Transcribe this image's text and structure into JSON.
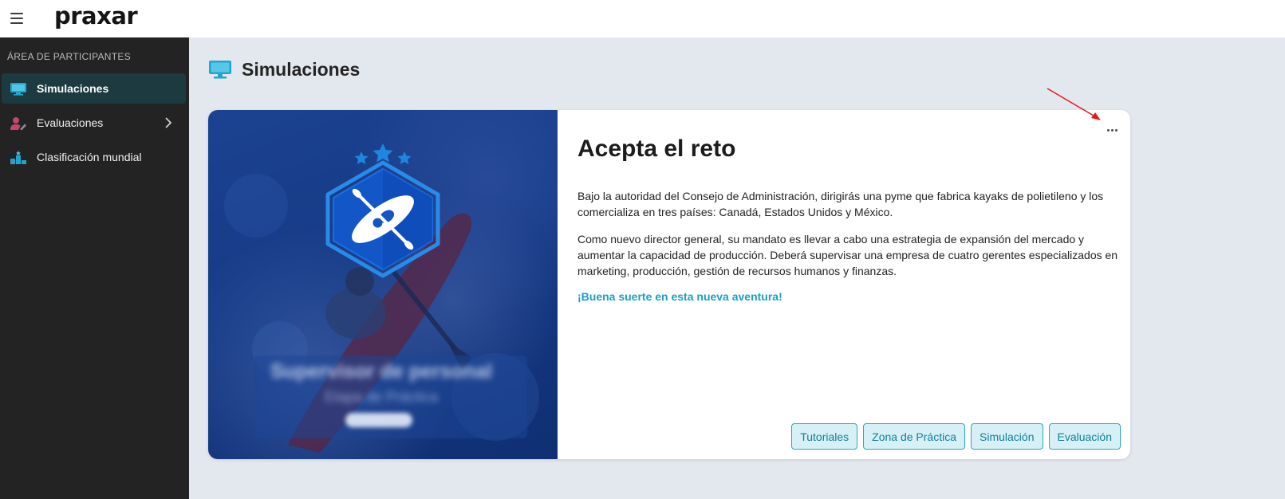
{
  "app": {
    "logo_text": "praxar",
    "colors": {
      "accent": "#1aa0c4",
      "sidebar_bg": "#232323",
      "sidebar_active": "#1c3a40"
    }
  },
  "topbar": {
    "menu_icon": "hamburger-icon"
  },
  "sidebar": {
    "heading": "ÁREA DE PARTICIPANTES",
    "items": [
      {
        "label": "Simulaciones",
        "icon": "monitor-icon",
        "active": true
      },
      {
        "label": "Evaluaciones",
        "icon": "user-edit-icon",
        "has_submenu": true
      },
      {
        "label": "Clasificación mundial",
        "icon": "podium-icon"
      }
    ]
  },
  "page": {
    "title": "Simulaciones",
    "title_icon": "monitor-icon"
  },
  "card": {
    "title": "Acepta el reto",
    "paragraphs": [
      "Bajo la autoridad del Consejo de Administración, dirigirás una pyme que fabrica kayaks de polietileno y los comercializa en tres países: Canadá, Estados Unidos y México.",
      "Como nuevo director general, su mandato es llevar a cabo una estrategia de expansión del mercado y aumentar la capacidad de producción. Deberá supervisar una empresa de cuatro gerentes especializados en marketing, producción, gestión de recursos humanos y finanzas."
    ],
    "highlight": "¡Buena suerte en esta nueva aventura!",
    "image_badge_icon": "kayak-badge-icon",
    "blurred_overlay": {
      "title": "Supervisor de personal",
      "subtitle": "Etapa de Práctica"
    },
    "actions": [
      {
        "label": "Tutoriales"
      },
      {
        "label": "Zona de Práctica"
      },
      {
        "label": "Simulación"
      },
      {
        "label": "Evaluación"
      }
    ]
  }
}
